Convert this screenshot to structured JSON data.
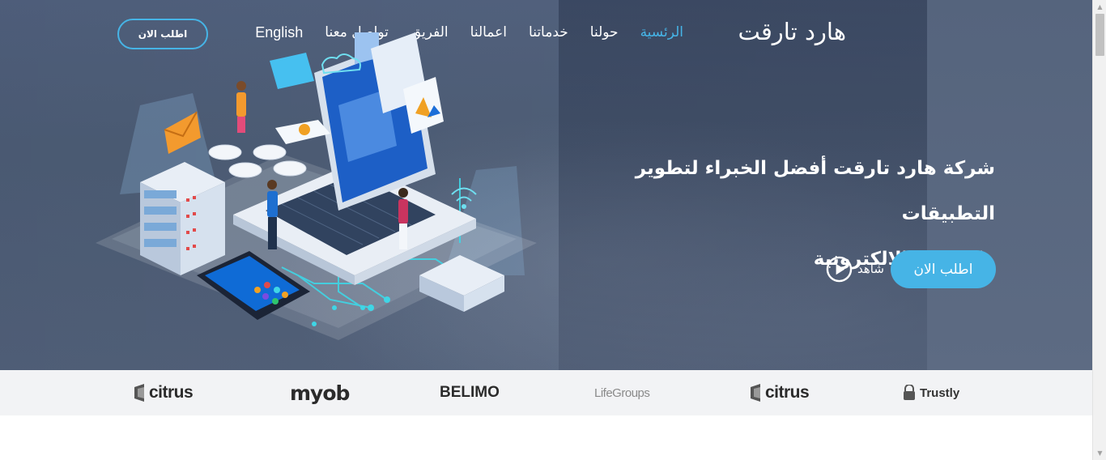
{
  "nav": {
    "brand": "هارد تارقت",
    "items": [
      {
        "label": "الرئسية",
        "active": true
      },
      {
        "label": "حولنا",
        "active": false
      },
      {
        "label": "خدماتنا",
        "active": false
      },
      {
        "label": "اعمالنا",
        "active": false
      },
      {
        "label": "الفريق",
        "active": false
      },
      {
        "label": "تواصل معنا",
        "active": false
      }
    ],
    "language": "English",
    "cta_label": "اطلب الان"
  },
  "hero": {
    "title_line1": "شركة هارد تارقت أفضل الخبراء لتطوير التطبيقات",
    "title_line2": "والمواقع الالكترونية",
    "cta_label": "اطلب الان",
    "watch_label": "شاهد",
    "play_icon": "play-circle-icon",
    "illustration": "isometric-laptop-servers-illustration"
  },
  "clients": [
    {
      "name": "citrus",
      "icon": "citrus-logo-icon"
    },
    {
      "name": "myob",
      "icon": "myob-logo-icon"
    },
    {
      "name": "BELIMO",
      "icon": "belimo-logo-icon"
    },
    {
      "name": "LifeGroups",
      "icon": "lifegroups-logo-icon"
    },
    {
      "name": "citrus",
      "icon": "citrus-logo-icon"
    },
    {
      "name": "Trustly",
      "icon": "trustly-logo-icon"
    }
  ],
  "colors": {
    "accent": "#46b4e6",
    "hero_bg": "#4a5a77",
    "logos_bg": "#f2f3f5"
  }
}
